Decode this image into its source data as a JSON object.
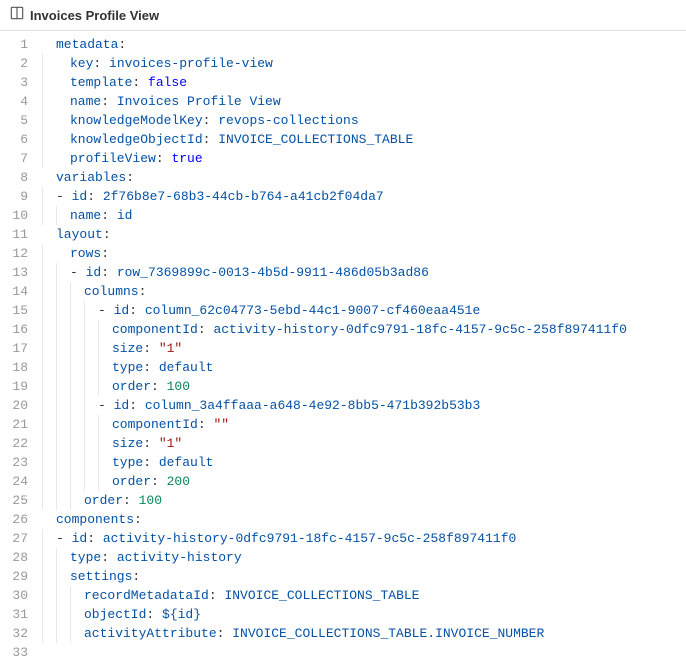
{
  "header": {
    "title": "Invoices Profile View"
  },
  "code": {
    "l1k": "metadata",
    "l1c": ":",
    "l2k": "key",
    "l2v": "invoices-profile-view",
    "l3k": "template",
    "l3v": "false",
    "l4k": "name",
    "l4v": "Invoices Profile View",
    "l5k": "knowledgeModelKey",
    "l5v": "revops-collections",
    "l6k": "knowledgeObjectId",
    "l6v": "INVOICE_COLLECTIONS_TABLE",
    "l7k": "profileView",
    "l7v": "true",
    "l8k": "variables",
    "l8c": ":",
    "l9k": "id",
    "l9v": "2f76b8e7-68b3-44cb-b764-a41cb2f04da7",
    "l10k": "name",
    "l10v": "id",
    "l11k": "layout",
    "l11c": ":",
    "l12k": "rows",
    "l12c": ":",
    "l13k": "id",
    "l13v": "row_7369899c-0013-4b5d-9911-486d05b3ad86",
    "l14k": "columns",
    "l14c": ":",
    "l15k": "id",
    "l15v": "column_62c04773-5ebd-44c1-9007-cf460eaa451e",
    "l16k": "componentId",
    "l16v": "activity-history-0dfc9791-18fc-4157-9c5c-258f897411f0",
    "l17k": "size",
    "l17v": "\"1\"",
    "l18k": "type",
    "l18v": "default",
    "l19k": "order",
    "l19v": "100",
    "l20k": "id",
    "l20v": "column_3a4ffaaa-a648-4e92-8bb5-471b392b53b3",
    "l21k": "componentId",
    "l21v": "\"\"",
    "l22k": "size",
    "l22v": "\"1\"",
    "l23k": "type",
    "l23v": "default",
    "l24k": "order",
    "l24v": "200",
    "l25k": "order",
    "l25v": "100",
    "l26k": "components",
    "l26c": ":",
    "l27k": "id",
    "l27v": "activity-history-0dfc9791-18fc-4157-9c5c-258f897411f0",
    "l28k": "type",
    "l28v": "activity-history",
    "l29k": "settings",
    "l29c": ":",
    "l30k": "recordMetadataId",
    "l30v": "INVOICE_COLLECTIONS_TABLE",
    "l31k": "objectId",
    "l31v": "${id}",
    "l32k": "activityAttribute",
    "l32v": "INVOICE_COLLECTIONS_TABLE.INVOICE_NUMBER"
  },
  "lineNumbers": [
    "1",
    "2",
    "3",
    "4",
    "5",
    "6",
    "7",
    "8",
    "9",
    "10",
    "11",
    "12",
    "13",
    "14",
    "15",
    "16",
    "17",
    "18",
    "19",
    "20",
    "21",
    "22",
    "23",
    "24",
    "25",
    "26",
    "27",
    "28",
    "29",
    "30",
    "31",
    "32",
    "33"
  ]
}
